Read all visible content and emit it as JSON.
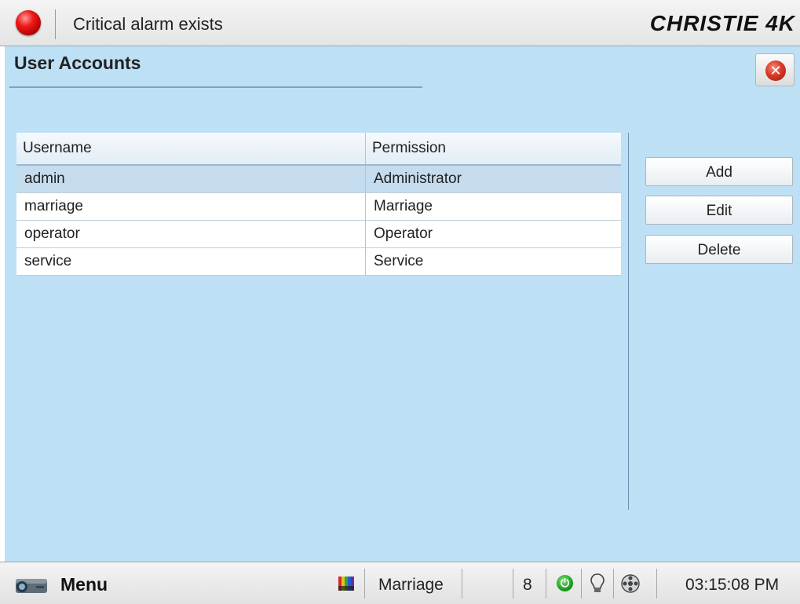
{
  "header": {
    "alarm_text": "Critical alarm exists",
    "alarm_color": "#e01010",
    "brand": "CHRISTIE 4K"
  },
  "page": {
    "title": "User Accounts",
    "close_icon": "close-icon",
    "background_color": "#bde0f5"
  },
  "table": {
    "columns": [
      "Username",
      "Permission"
    ],
    "rows": [
      {
        "username": "admin",
        "permission": "Administrator"
      },
      {
        "username": "marriage",
        "permission": "Marriage"
      },
      {
        "username": "operator",
        "permission": "Operator"
      },
      {
        "username": "service",
        "permission": "Service"
      }
    ],
    "selected_row": 0
  },
  "actions": {
    "add": "Add",
    "edit": "Edit",
    "delete": "Delete"
  },
  "footer": {
    "menu_label": "Menu",
    "active_user": "Marriage",
    "channel": "8",
    "time": "03:15:08 PM",
    "icons": [
      "projector-icon",
      "test-pattern-icon",
      "power-icon",
      "lamp-icon",
      "film-reel-icon"
    ]
  }
}
